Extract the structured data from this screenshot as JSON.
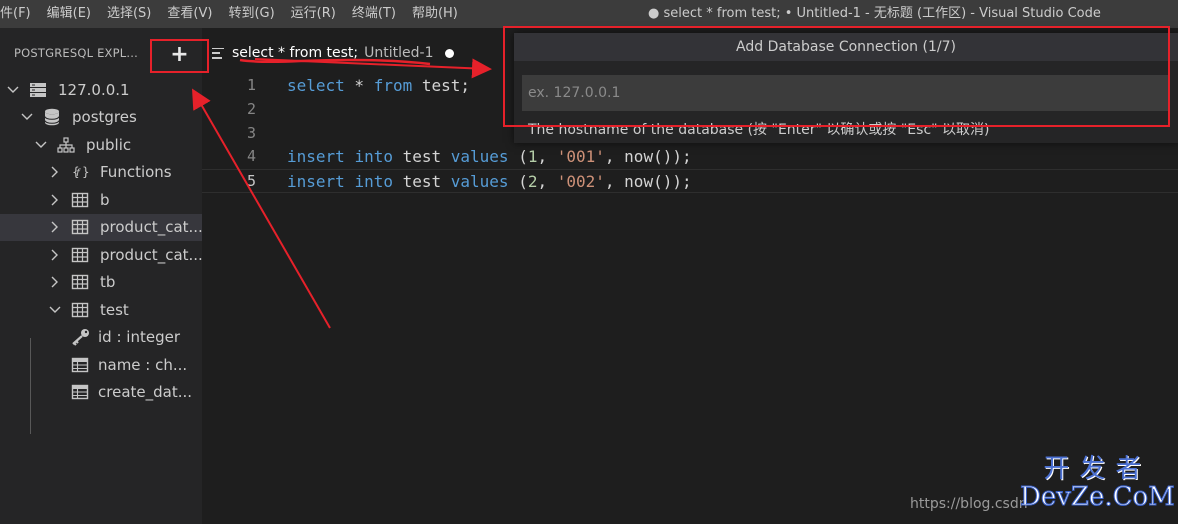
{
  "menu": [
    "件(F)",
    "编辑(E)",
    "选择(S)",
    "查看(V)",
    "转到(G)",
    "运行(R)",
    "终端(T)",
    "帮助(H)"
  ],
  "window_title": "● select * from test; • Untitled-1 - 无标题 (工作区) - Visual Studio Code",
  "sidebar": {
    "title": "POSTGRESQL EXPL...",
    "add_label": "+",
    "tree": [
      {
        "label": "127.0.0.1",
        "icon": "server-icon",
        "expanded": true
      },
      {
        "label": "postgres",
        "icon": "database-icon",
        "expanded": true
      },
      {
        "label": "public",
        "icon": "schema-icon",
        "expanded": true
      },
      {
        "label": "Functions",
        "icon": "function-icon",
        "expanded": false
      },
      {
        "label": "b",
        "icon": "table-icon",
        "expanded": false
      },
      {
        "label": "product_cat...",
        "icon": "table-icon",
        "expanded": false
      },
      {
        "label": "product_cat...",
        "icon": "table-icon",
        "expanded": false
      },
      {
        "label": "tb",
        "icon": "table-icon",
        "expanded": false
      },
      {
        "label": "test",
        "icon": "table-icon",
        "expanded": true
      },
      {
        "label": "id : integer",
        "icon": "key-icon"
      },
      {
        "label": "name : ch...",
        "icon": "column-icon"
      },
      {
        "label": "create_dat...",
        "icon": "column-icon"
      }
    ]
  },
  "tab": {
    "name": "select * from test;",
    "file": "Untitled-1"
  },
  "editor": {
    "line_numbers": [
      "1",
      "2",
      "3",
      "4",
      "5"
    ],
    "lines": [
      [
        {
          "t": "kw",
          "v": "select"
        },
        {
          "t": "p",
          "v": " * "
        },
        {
          "t": "kw",
          "v": "from"
        },
        {
          "t": "p",
          "v": " test;"
        }
      ],
      [],
      [],
      [
        {
          "t": "kw",
          "v": "insert"
        },
        {
          "t": "p",
          "v": " "
        },
        {
          "t": "kw",
          "v": "into"
        },
        {
          "t": "p",
          "v": " test "
        },
        {
          "t": "kw",
          "v": "values"
        },
        {
          "t": "p",
          "v": " ("
        },
        {
          "t": "num",
          "v": "1"
        },
        {
          "t": "p",
          "v": ", "
        },
        {
          "t": "str",
          "v": "'001'"
        },
        {
          "t": "p",
          "v": ", now());"
        }
      ],
      [
        {
          "t": "kw",
          "v": "insert"
        },
        {
          "t": "p",
          "v": " "
        },
        {
          "t": "kw",
          "v": "into"
        },
        {
          "t": "p",
          "v": " test "
        },
        {
          "t": "kw",
          "v": "values"
        },
        {
          "t": "p",
          "v": " ("
        },
        {
          "t": "num",
          "v": "2"
        },
        {
          "t": "p",
          "v": ", "
        },
        {
          "t": "str",
          "v": "'002'"
        },
        {
          "t": "p",
          "v": ", now());"
        }
      ]
    ]
  },
  "quick_input": {
    "title": "Add Database Connection (1/7)",
    "placeholder": "ex. 127.0.0.1",
    "message": "The hostname of the database (按 \"Enter\" 以确认或按 \"Esc\" 以取消)"
  },
  "watermark": {
    "url": "https://blog.csdn",
    "logo_cn": "开发者",
    "logo_en": "DevZe.CoM"
  },
  "colors": {
    "annotation": "#e6212a",
    "keyword": "#569cd6",
    "string": "#ce9178",
    "number": "#b5cea8"
  }
}
